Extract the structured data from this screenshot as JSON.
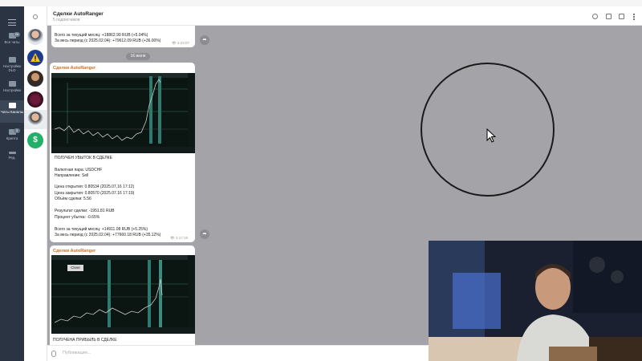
{
  "channel": {
    "title": "Сделки AutoRanger",
    "subscribers": "5 подписчиков"
  },
  "folders": [
    {
      "label": "Все чаты",
      "badge": "26",
      "active": false
    },
    {
      "label": "Настройки DLD",
      "badge": "",
      "active": false
    },
    {
      "label": "Настройки",
      "badge": "",
      "active": false
    },
    {
      "label": "Чаты Каналы",
      "badge": "",
      "active": true
    },
    {
      "label": "Крипта",
      "badge": "3",
      "active": false
    },
    {
      "label": "Ред.",
      "badge": "",
      "active": false
    }
  ],
  "message1": {
    "line1": "Всего за текущий месяц: +18862.99 RUB (+5.04%)",
    "line2": "За весь период (с 2025.02.04): +79612.09 RUB (+36.00%)",
    "views": "3",
    "time": "23:07"
  },
  "date_chip": "16 июля",
  "message2": {
    "sender": "Сделки AutoRanger",
    "title": "ПОЛУЧЕН УБЫТОК В СДЕЛКЕ",
    "pair": "Валютная пара: USDCHF",
    "direction": "Направление: Sell",
    "open": "Цена открытия: 0.80534 (2025.07.16 17:12)",
    "close": "Цена закрытия: 0.80570 (2025.07.16 17:19)",
    "volume": "Объём сделки: 5.56",
    "result": "Результат сделки: -1951.81 RUB",
    "loss_pct": "Процент убытка: -0.65%",
    "month": "Всего за текущий месяц: +14911.08 RUB (+5.25%)",
    "period": "За весь период (с 2025.02.04): +77660.18 RUB (+35.12%)",
    "views": "3",
    "time": "17:19"
  },
  "message3": {
    "sender": "Сделки AutoRanger",
    "title": "ПОЛУЧЕНА ПРИБЫЛЬ В СДЕЛКЕ",
    "chart_button": "Close"
  },
  "composer": {
    "placeholder": "Публикация..."
  },
  "icons": {
    "search": "search-icon",
    "forward": "forward-icon",
    "views": "eye-icon"
  }
}
